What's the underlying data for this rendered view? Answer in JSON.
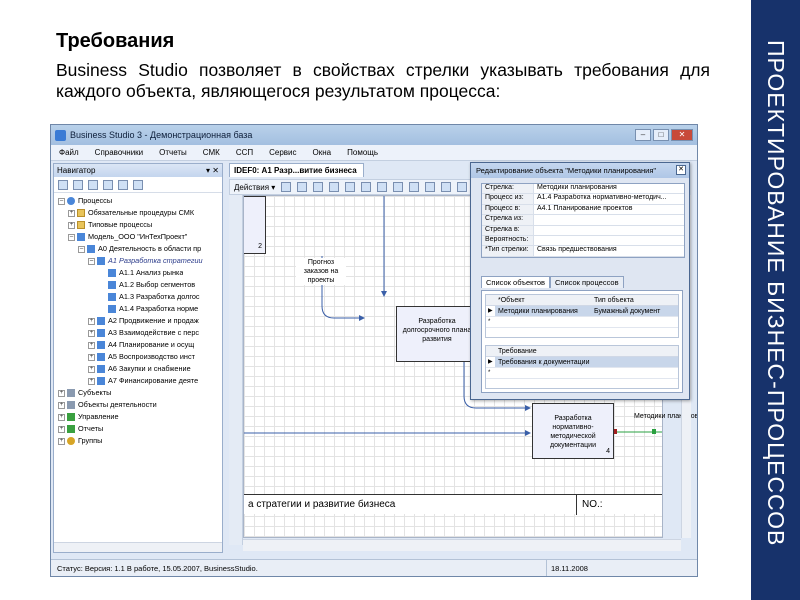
{
  "slide": {
    "title": "Требования",
    "body": "Business Studio позволяет в свойствах стрелки указывать требования для каждого объекта, являющегося результатом процесса:",
    "side_label": "ПРОЕКТИРОВАНИЕ БИЗНЕС-ПРОЦЕССОВ",
    "colors": {
      "band": "#17326b",
      "window_bg": "#dfe8f5"
    }
  },
  "window": {
    "title": "Business Studio 3 - Демонстрационная база",
    "menu": [
      "Файл",
      "Справочники",
      "Отчеты",
      "СМК",
      "ССП",
      "Сервис",
      "Окна",
      "Помощь"
    ],
    "status": "Статус: Версия: 1.1  В работе, 15.05.2007, BusinessStudio.",
    "status_date": "18.11.2008"
  },
  "navigator": {
    "title": "Навигатор",
    "pin": "▾ ✕",
    "tree": [
      {
        "label": "Процессы",
        "icon": "proc"
      },
      {
        "label": "Обязательные процедуры СМК",
        "icon": "folder"
      },
      {
        "label": "Типовые процессы",
        "icon": "folder"
      },
      {
        "label": "Модель_ООО \"ИнТехПроект\"",
        "icon": "node"
      },
      {
        "label": "А0 Деятельность в области пр",
        "icon": "node"
      },
      {
        "label": "А1 Разработка стратегии",
        "icon": "node"
      },
      {
        "label": "А1.1 Анализ рынка",
        "icon": "node"
      },
      {
        "label": "А1.2 Выбор сегментов",
        "icon": "node"
      },
      {
        "label": "А1.3 Разработка долгос",
        "icon": "node"
      },
      {
        "label": "А1.4 Разработка норме",
        "icon": "node"
      },
      {
        "label": "А2 Продвижение и продаж",
        "icon": "node"
      },
      {
        "label": "А3 Взаимодействие с перс",
        "icon": "node"
      },
      {
        "label": "А4 Планирование и осущ",
        "icon": "node"
      },
      {
        "label": "А5 Воспроизводство инст",
        "icon": "node"
      },
      {
        "label": "А6 Закупки и снабжение",
        "icon": "node"
      },
      {
        "label": "А7 Финансирование деяте",
        "icon": "node"
      },
      {
        "label": "Субъекты",
        "icon": "gray"
      },
      {
        "label": "Объекты деятельности",
        "icon": "gray"
      },
      {
        "label": "Управление",
        "icon": "green"
      },
      {
        "label": "Отчеты",
        "icon": "green"
      },
      {
        "label": "Группы",
        "icon": "key"
      }
    ]
  },
  "editor": {
    "tab": "IDEF0: А1 Разр...витие бизнеса",
    "actions_label": "Действия ▾",
    "label_forecast": "Прогноз заказов на проекты",
    "box1": {
      "label": "Разработка долгосрочного плана развития",
      "num": "3"
    },
    "box2": {
      "label": "Разработка нормативно-методической документации",
      "num": "4"
    },
    "box0_num": "2",
    "label_methods": "Методики планирования",
    "footer_text": "а стратегии и развитие бизнеса",
    "footer_no": "NO.:"
  },
  "dialog": {
    "title": "Редактирование объекта \"Методики планирования\"",
    "close": "✕",
    "props": [
      {
        "k": "Стрелка:",
        "v": "Методики планирования"
      },
      {
        "k": "Процесс из:",
        "v": "А1.4 Разработка нормативно-методич..."
      },
      {
        "k": "Процесс в:",
        "v": "А4.1 Планирование проектов"
      },
      {
        "k": "Стрелка из:",
        "v": ""
      },
      {
        "k": "Стрелка в:",
        "v": ""
      },
      {
        "k": "Вероятность:",
        "v": ""
      },
      {
        "k": "*Тип стрелки:",
        "v": "Связь предшествования"
      }
    ],
    "tabs": [
      "Список объектов",
      "Список процессов"
    ],
    "grid1_headers": [
      "*Объект",
      "Тип объекта"
    ],
    "grid1_row": {
      "obj": "Методики планирования",
      "type": "Бумажный документ"
    },
    "grid2_header": "Требование",
    "grid2_row": "Требования к документации"
  }
}
